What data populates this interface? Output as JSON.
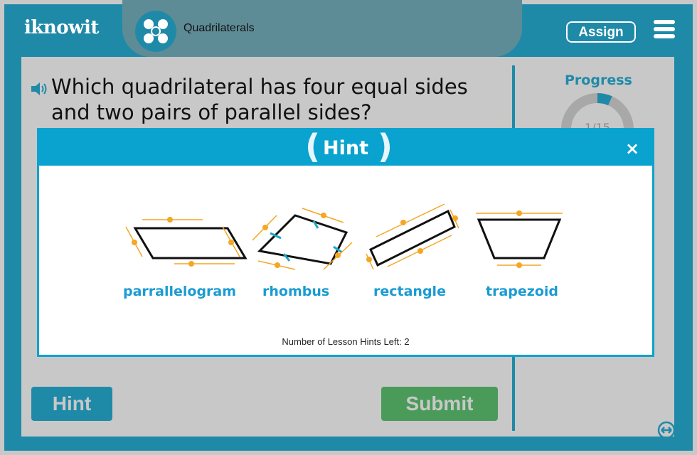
{
  "app": {
    "logo_text": "iknowit",
    "topic_title": "Quadrilaterals",
    "assign_label": "Assign",
    "menu_icon": "hamburger-menu-icon"
  },
  "question": {
    "speaker_icon": "speaker-icon",
    "text": "Which quadrilateral has four equal sides and two pairs of parallel sides?"
  },
  "progress": {
    "title": "Progress",
    "text": "1/15",
    "current": 1,
    "total": 15
  },
  "buttons": {
    "hint_label": "Hint",
    "submit_label": "Submit"
  },
  "hint_modal": {
    "title": "Hint",
    "close_label": "×",
    "shapes": [
      {
        "label": "parrallelogram"
      },
      {
        "label": "rhombus"
      },
      {
        "label": "rectangle"
      },
      {
        "label": "trapezoid"
      }
    ],
    "hints_left_text": "Number of Lesson Hints Left: 2"
  },
  "colors": {
    "brand": "#1f8aa8",
    "hint_accent": "#0aa3cf",
    "submit": "#4a9b5a",
    "marker": "#f5a623",
    "tick": "#1aa6c8"
  }
}
